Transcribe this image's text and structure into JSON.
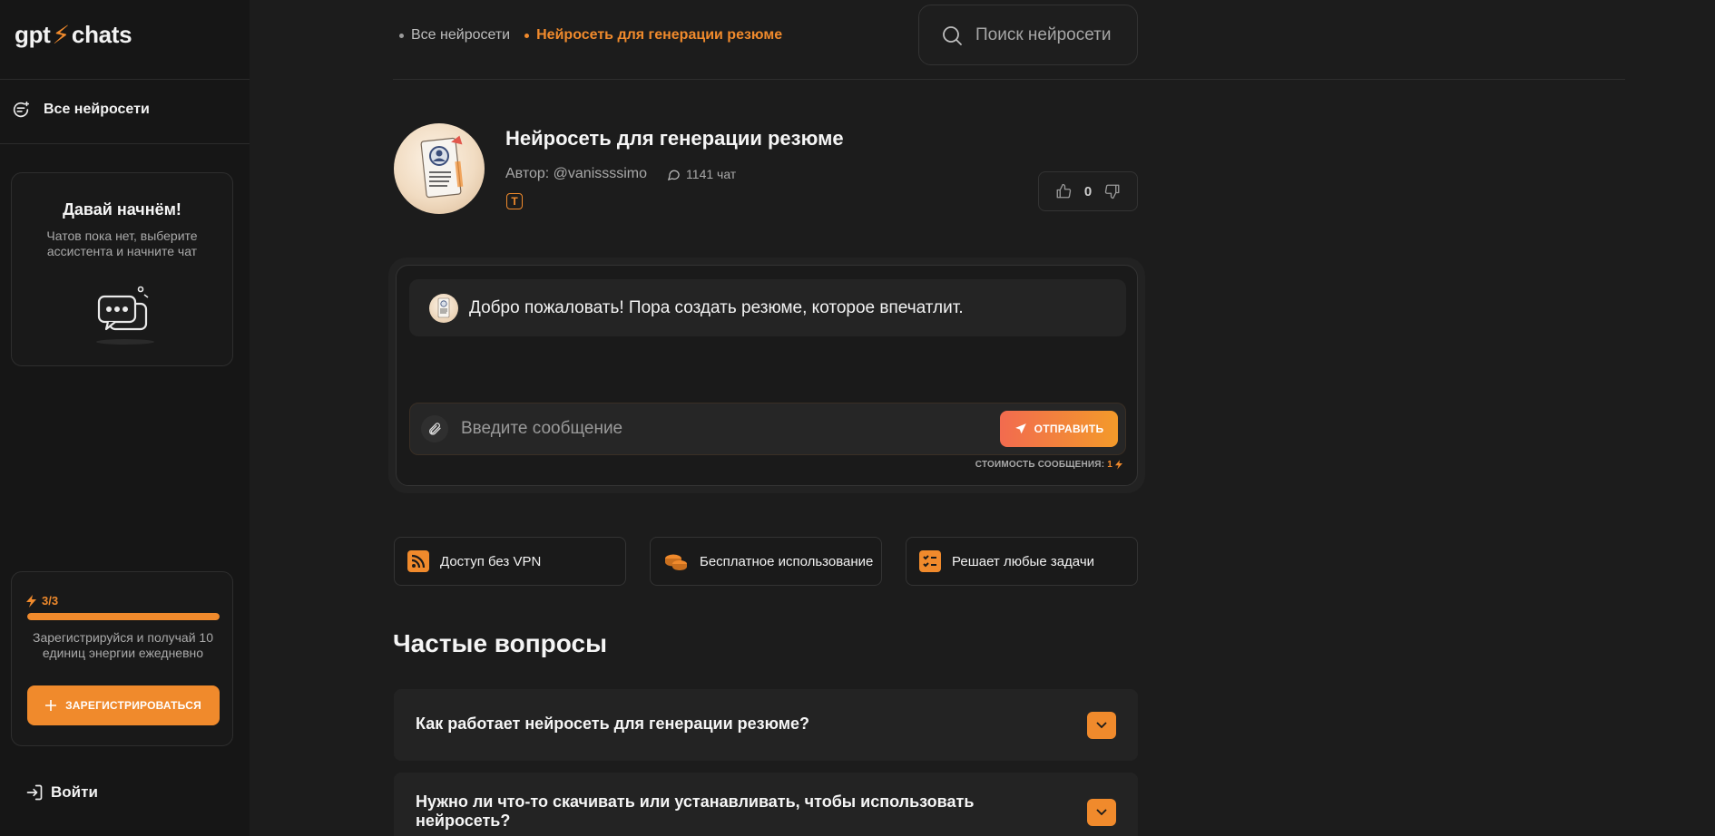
{
  "logo": {
    "left": "gpt",
    "bolt": "⚡",
    "right": "chats"
  },
  "sidebar": {
    "all_networks": "Все нейросети",
    "start_card": {
      "title": "Давай начнём!",
      "text": "Чатов пока нет, выберите ассистента и начните чат"
    },
    "energy": {
      "count": "3/3",
      "fraction": 1.0,
      "text": "Зарегистрируйся и получай 10 единиц энергии ежедневно",
      "register_label": "ЗАРЕГИСТРИРОВАТЬСЯ"
    },
    "login_label": "Войти"
  },
  "breadcrumb": [
    "Все нейросети",
    "Нейросеть для генерации резюме"
  ],
  "search": {
    "placeholder": "Поиск нейросети"
  },
  "bot": {
    "title": "Нейросеть для генерации резюме",
    "author": "Автор: @vanissssimo",
    "chats": "1141 чат",
    "badge": "T",
    "rating": "0"
  },
  "chat": {
    "welcome": "Добро пожаловать! Пора создать резюме, которое впечатлит.",
    "input_placeholder": "Введите сообщение",
    "send_label": "ОТПРАВИТЬ",
    "cost_label": "СТОИМОСТЬ СООБЩЕНИЯ:",
    "cost_value": "1"
  },
  "features": [
    "Доступ без VPN",
    "Бесплатное использование",
    "Решает любые задачи"
  ],
  "faq": {
    "title": "Частые вопросы",
    "items": [
      "Как работает нейросеть для генерации резюме?",
      "Нужно ли что-то скачивать или устанавливать, чтобы использовать нейросеть?"
    ]
  },
  "colors": {
    "accent": "#f08a2c",
    "background": "#1c1c1c",
    "sidebar": "#161616"
  }
}
